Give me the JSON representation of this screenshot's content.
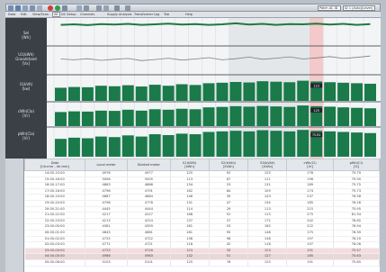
{
  "window": {
    "title_right_fields": [
      "Patch AC ID",
      "ID 1 (Auto)(Level)"
    ]
  },
  "menubar": {
    "items": [
      "Data",
      "Edit",
      "View/Scan",
      "Alt",
      "DC Setup",
      "Channels",
      "Supply Analysis",
      "Transformer",
      "Log",
      "Tab",
      "Help"
    ],
    "active_index": 3
  },
  "sidebar": {
    "labels": [
      {
        "line1": "Sel",
        "line2": "[Wh]"
      },
      {
        "line1": "U1(kWh)",
        "line2": "Grandstand",
        "line3": "[Vx]"
      },
      {
        "line1": "I1(kVA)",
        "line2": "[kw]"
      },
      {
        "line1": "cWh(Cla)",
        "line2": "[Vr]"
      },
      {
        "line1": "pWh(Cla)",
        "line2": "[Vr]"
      }
    ]
  },
  "chart_data": [
    {
      "type": "line",
      "series": [
        {
          "values": [
            0.8,
            0.82,
            0.79,
            0.83,
            0.81,
            0.84,
            0.8,
            0.82,
            0.85,
            0.81,
            0.83,
            0.8,
            0.82,
            0.86,
            0.81,
            0.84,
            0.8,
            0.83,
            0.82,
            0.85,
            0.81,
            0.84,
            0.8,
            0.83
          ]
        }
      ],
      "color": "#1f7a3a"
    },
    {
      "type": "line",
      "series": [
        {
          "values": [
            0.55,
            0.52,
            0.56,
            0.5,
            0.54,
            0.57,
            0.49,
            0.53,
            0.58,
            0.51,
            0.55,
            0.6,
            0.52,
            0.56,
            0.62,
            0.54,
            0.58,
            0.63,
            0.55,
            0.59,
            0.64,
            0.57,
            0.61,
            0.66
          ]
        }
      ],
      "color": "#7a8088"
    },
    {
      "type": "bar",
      "values": [
        0.52,
        0.55,
        0.54,
        0.6,
        0.58,
        0.62,
        0.57,
        0.64,
        0.6,
        0.66,
        0.63,
        0.7,
        0.72,
        0.75,
        0.73,
        0.78,
        0.76,
        0.74,
        0.8,
        0.77,
        0.74,
        0.72,
        0.7,
        0.68
      ],
      "annotation": {
        "index": 19,
        "label": "123"
      },
      "color": "#1a7a4a"
    },
    {
      "type": "bar",
      "values": [
        0.6,
        0.63,
        0.62,
        0.66,
        0.65,
        0.7,
        0.66,
        0.72,
        0.7,
        0.74,
        0.72,
        0.8,
        0.82,
        0.85,
        0.83,
        0.86,
        0.84,
        0.82,
        0.88,
        0.85,
        0.83,
        0.8,
        0.78,
        0.76
      ],
      "annotation": {
        "index": 19,
        "label": "125"
      },
      "color": "#1a7a4a"
    },
    {
      "type": "bar",
      "values": [
        0.62,
        0.66,
        0.64,
        0.7,
        0.68,
        0.74,
        0.7,
        0.78,
        0.75,
        0.8,
        0.78,
        0.86,
        0.88,
        0.9,
        0.88,
        0.92,
        0.9,
        0.88,
        0.93,
        0.9,
        0.88,
        0.86,
        0.84,
        0.82
      ],
      "annotation": {
        "index": 19,
        "label": "75.81"
      },
      "color": "#1a7a4a"
    }
  ],
  "table": {
    "headers": [
      {
        "l1": "Date",
        "l2": "[hh:mm - hh:mm]"
      },
      {
        "l1": "Local meter",
        "l2": ""
      },
      {
        "l1": "Started meter",
        "l2": ""
      },
      {
        "l1": "S1(kWh)",
        "l2": "[kWh]"
      },
      {
        "l1": "S2(kVAh)",
        "l2": "[kVAh]"
      },
      {
        "l1": "S3(kVAh)",
        "l2": "[kVAh]"
      },
      {
        "l1": "cWh(Cl)",
        "l2": "[Vr]"
      },
      {
        "l1": "pWh(Cl)",
        "l2": "[%]"
      }
    ],
    "rows": [
      [
        "14:00-15:00",
        "4976",
        "4977",
        "125",
        "92",
        "125",
        "176",
        "75.79"
      ],
      [
        "15:00-16:00",
        "5006",
        "5005",
        "113",
        "87",
        "111",
        "156",
        "75.90"
      ],
      [
        "16:00-17:00",
        "4863",
        "4866",
        "134",
        "25",
        "131",
        "189",
        "75.75"
      ],
      [
        "17:00-18:00",
        "4798",
        "4791",
        "162",
        "84",
        "109",
        "174",
        "75.73"
      ],
      [
        "18:00-19:00",
        "4687",
        "4684",
        "146",
        "39",
        "143",
        "237",
        "76.58"
      ],
      [
        "19:00-20:00",
        "4796",
        "4778",
        "131",
        "47",
        "134",
        "185",
        "76.28"
      ],
      [
        "20:00-21:00",
        "4445",
        "4444",
        "114",
        "29",
        "113",
        "215",
        "75.95"
      ],
      [
        "21:00-22:00",
        "4217",
        "4227",
        "188",
        "91",
        "115",
        "275",
        "81.34"
      ],
      [
        "22:00-23:00",
        "4213",
        "4224",
        "137",
        "37",
        "172",
        "242",
        "78.65"
      ],
      [
        "23:00-00:00",
        "4361",
        "4359",
        "161",
        "53",
        "165",
        "222",
        "76.94"
      ],
      [
        "00:00-01:00",
        "4643",
        "4681",
        "181",
        "95",
        "148",
        "175",
        "76.39"
      ],
      [
        "01:00-02:00",
        "4725",
        "4722",
        "136",
        "98",
        "136",
        "197",
        "76.20"
      ],
      [
        "02:00-03:00",
        "4771",
        "4721",
        "118",
        "42",
        "118",
        "197",
        "76.06"
      ],
      [
        "03:00-04:00",
        "4723",
        "4716",
        "123",
        "33",
        "123",
        "191",
        "75.57"
      ],
      [
        "04:00-05:00",
        "4986",
        "4983",
        "132",
        "51",
        "127",
        "185",
        "75.63"
      ],
      [
        "05:00-06:00",
        "5103",
        "5101",
        "125",
        "76",
        "125",
        "191",
        "75.65"
      ]
    ],
    "highlight_rows": [
      13
    ],
    "highlight_rows_alt": [
      14
    ]
  }
}
